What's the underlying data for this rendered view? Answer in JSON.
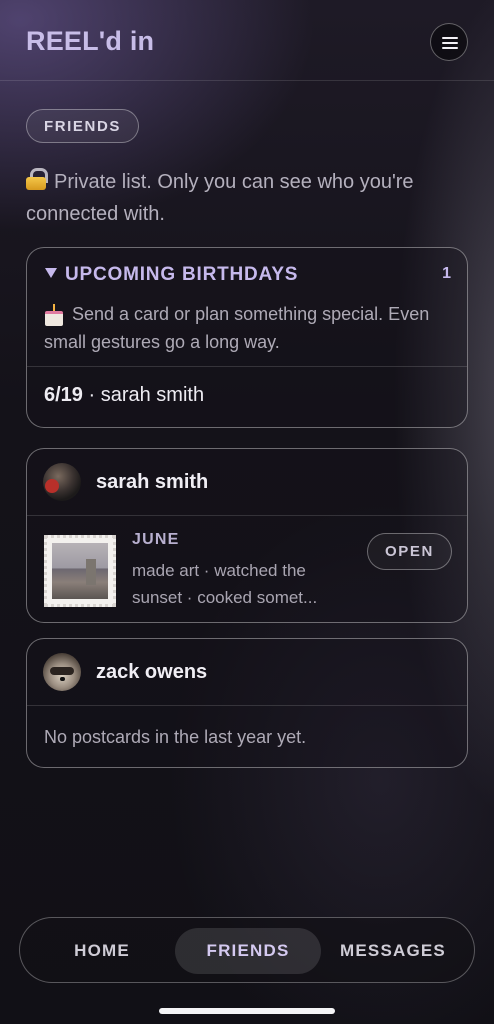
{
  "app": {
    "title": "REEL'd in"
  },
  "header": {
    "menu_icon": "hamburger-menu-icon"
  },
  "section": {
    "label": "FRIENDS"
  },
  "privacy": {
    "icon": "lock-icon",
    "text": "Private list. Only you can see who you're connected with."
  },
  "birthdays": {
    "title": "UPCOMING BIRTHDAYS",
    "count": "1",
    "icon": "cake-icon",
    "description": "Send a card or plan something special. Even small gestures go a long way.",
    "entries": [
      {
        "date": "6/19",
        "separator": " · ",
        "name": "sarah smith"
      }
    ]
  },
  "friends": [
    {
      "name": "sarah smith",
      "postcard": {
        "month": "JUNE",
        "summary": "made art · watched the sunset · cooked somet...",
        "open_label": "OPEN"
      }
    },
    {
      "name": "zack owens",
      "empty_text": "No postcards in the last year yet."
    }
  ],
  "nav": {
    "home": "HOME",
    "friends": "FRIENDS",
    "messages": "MESSAGES",
    "active": "friends"
  }
}
